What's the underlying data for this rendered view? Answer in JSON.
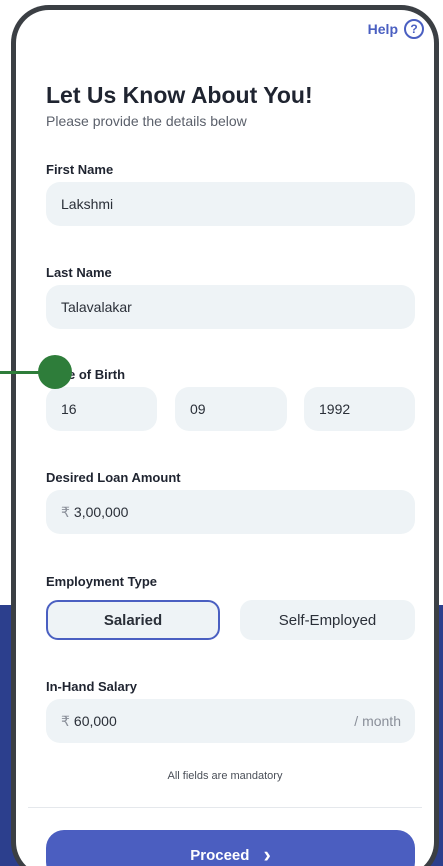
{
  "help": {
    "label": "Help",
    "icon": "?"
  },
  "title": "Let Us Know About You!",
  "subtitle": "Please provide the details below",
  "first_name": {
    "label": "First Name",
    "value": "Lakshmi"
  },
  "last_name": {
    "label": "Last Name",
    "value": "Talavalakar"
  },
  "dob": {
    "label": "e of Birth",
    "day": "16",
    "month": "09",
    "year": "1992"
  },
  "loan": {
    "label": "Desired Loan Amount",
    "currency": "₹",
    "value": "3,00,000"
  },
  "employment": {
    "label": "Employment Type",
    "options": [
      "Salaried",
      "Self-Employed"
    ],
    "selected": "Salaried"
  },
  "salary": {
    "label": "In-Hand Salary",
    "currency": "₹",
    "value": "60,000",
    "suffix": "/ month"
  },
  "mandatory_note": "All fields are mandatory",
  "proceed": {
    "label": "Proceed",
    "icon": "›"
  },
  "colors": {
    "accent": "#4a5fc1",
    "field_bg": "#eef3f6",
    "pointer": "#2e7d3a",
    "background_band": "#2c3f8d"
  }
}
